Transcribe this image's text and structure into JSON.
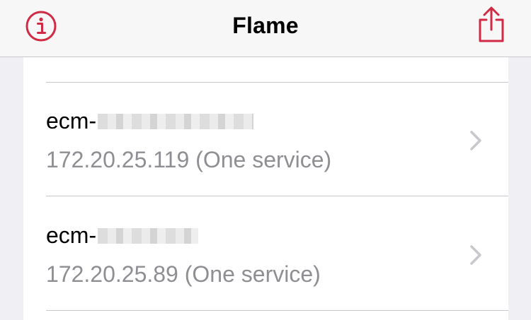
{
  "navbar": {
    "title": "Flame",
    "info_icon": "info-circle-icon",
    "share_icon": "share-icon",
    "accent_color": "#D12A44"
  },
  "list": {
    "rows": [
      {
        "title": "ecm-",
        "subtitle": "172.20.25.119 (One service)"
      },
      {
        "title": "ecm-",
        "subtitle": "172.20.25.89 (One service)"
      }
    ]
  }
}
